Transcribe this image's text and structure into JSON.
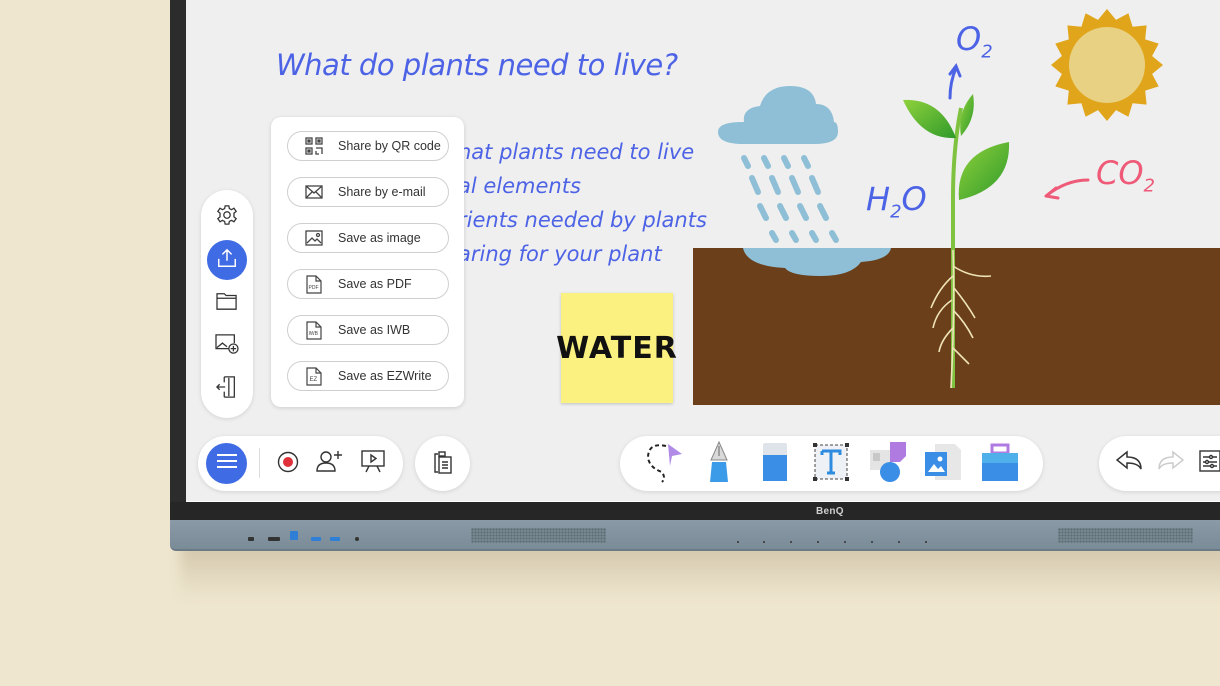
{
  "device": {
    "brand": "BenQ"
  },
  "whiteboard": {
    "title": "What do plants need to live?",
    "lines": [
      "hat plants need to live",
      "al elements",
      "rients needed by plants",
      "aring for your plant"
    ],
    "sticky_note": "WATER",
    "labels": {
      "oxygen": "O",
      "oxygen_sub": "2",
      "water_h": "H",
      "water_sub": "2",
      "water_o": "O",
      "co2": "CO",
      "co2_sub": "2"
    }
  },
  "share_menu": {
    "items": [
      {
        "label": "Share by QR code",
        "icon": "qr-code-icon"
      },
      {
        "label": "Share by e-mail",
        "icon": "envelope-icon"
      },
      {
        "label": "Save as image",
        "icon": "image-icon"
      },
      {
        "label": "Save as PDF",
        "icon": "pdf-file-icon",
        "badge": "PDF"
      },
      {
        "label": "Save as IWB",
        "icon": "iwb-file-icon",
        "badge": "IWB"
      },
      {
        "label": "Save as EZWrite",
        "icon": "ezwrite-file-icon",
        "badge": "EZ"
      }
    ]
  },
  "side_toolbar": {
    "items": [
      {
        "name": "settings",
        "icon": "gear-icon"
      },
      {
        "name": "share",
        "icon": "share-upload-icon",
        "active": true
      },
      {
        "name": "open-folder",
        "icon": "folder-icon"
      },
      {
        "name": "add-background",
        "icon": "add-image-icon"
      },
      {
        "name": "exit",
        "icon": "exit-door-icon"
      }
    ]
  },
  "bottom_toolbar": {
    "left": [
      "menu-icon",
      "record-icon",
      "invite-user-icon",
      "presentation-icon"
    ],
    "clipboard": "clipboard-icon",
    "tools": [
      "lasso-select-icon",
      "pen-icon",
      "eraser-icon",
      "text-icon",
      "shapes-icon",
      "insert-image-icon",
      "toolbox-icon"
    ],
    "right": [
      "undo-icon",
      "redo-icon",
      "adjust-settings-icon"
    ]
  },
  "colors": {
    "accent": "#3f6be4",
    "handwriting": "#4d63e6",
    "co2": "#ee5a78",
    "sticky": "#fbf180",
    "soil": "#6b3f1a",
    "cloud": "#8ebfd6",
    "sun_outer": "#e0a51a",
    "sun_inner": "#e8d183"
  }
}
